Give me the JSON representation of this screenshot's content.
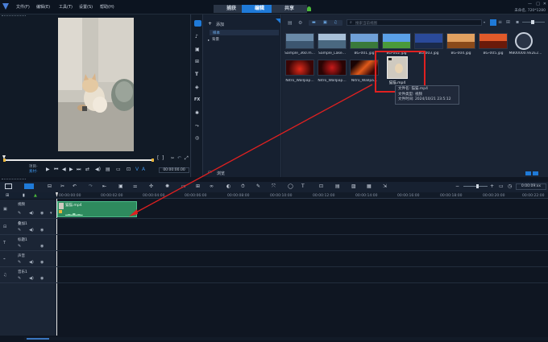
{
  "menubar": {
    "items": [
      "文件(F)",
      "编辑(E)",
      "工具(T)",
      "设置(S)",
      "帮助(H)"
    ],
    "tabs": [
      "捕获",
      "编辑",
      "共享"
    ],
    "active_tab": "编辑",
    "project_info": "未命名, 720*1280"
  },
  "player": {
    "project_label": "项目-",
    "clip_label": "素材-",
    "timecode": "00:00:00.00",
    "ab_label": "A"
  },
  "library": {
    "add_label": "添加",
    "tree_items": [
      "样本",
      "背景"
    ],
    "search_placeholder": "搜索当前视图",
    "browse_label": "浏览",
    "media": [
      {
        "name": "Sample_360.m...",
        "color": "#5a7894"
      },
      {
        "name": "Sample_Lake...",
        "color": "#8aa4be"
      },
      {
        "name": "BG-001.jpg",
        "color": "#3a6ea8"
      },
      {
        "name": "BG-002.jpg",
        "color": "#4d8fd0"
      },
      {
        "name": "BG-003.jpg",
        "color": "#2a4a8a"
      },
      {
        "name": "BG-004.jpg",
        "color": "#c27a3a"
      },
      {
        "name": "BG-005.jpg",
        "color": "#c24a2a"
      },
      {
        "name": "M800000.9x2E2...",
        "color": "#1a2434"
      },
      {
        "name": "Nitro_Wallpap...",
        "color": "#5a0a0a"
      },
      {
        "name": "Nitro_Wallpap...",
        "color": "#7a0c0c"
      },
      {
        "name": "Nitro_Wallpa...",
        "color": "#a8280a"
      },
      {
        "name": "猫猫.mp4",
        "color": "#cfcac0"
      }
    ],
    "tooltip": {
      "name_line": "文件名: 猫猫.mp4",
      "type_line": "文件类型: 视频",
      "time_line": "文件时间: 2024/10/21 23:5:12"
    }
  },
  "timeline": {
    "ruler_start": "00:00:00:00",
    "ruler": [
      "00:00:02:00",
      "00:00:04:00",
      "00:00:06:00",
      "00:00:08:00",
      "00:00:10:00",
      "00:00:12:00",
      "00:00:14:00",
      "00:00:16:00",
      "00:00:18:00",
      "00:00:20:00",
      "00:00:22:00"
    ],
    "timecode": "0:00:09:xx",
    "tracks": [
      "视频",
      "叠加1",
      "标题1",
      "声音",
      "音乐1"
    ],
    "clip_name": "猫猫.mp4"
  },
  "colors": {
    "accent": "#1f7ad8",
    "highlight_box": "#e02020",
    "clip_green": "#2e8a5e"
  }
}
